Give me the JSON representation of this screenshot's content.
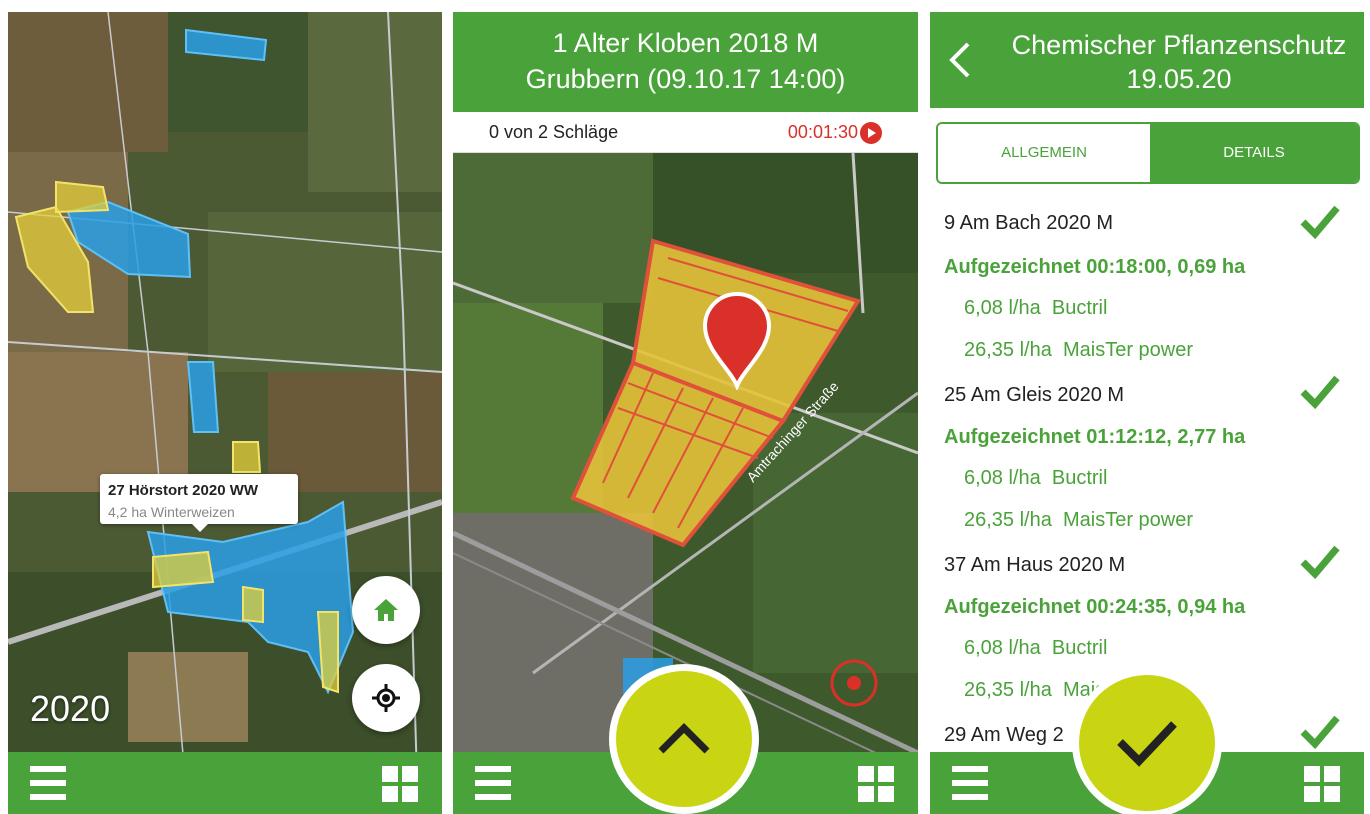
{
  "colors": {
    "brand_green": "#4aa23a",
    "accent_yellow": "#c9d512",
    "record_red": "#d9312a",
    "field_blue": "#2a9fe6",
    "field_yellow": "#e3cf3a"
  },
  "screen1": {
    "year": "2020",
    "tooltip": {
      "title": "27 Hörstort 2020 WW",
      "subtitle": "4,2 ha Winterweizen"
    },
    "buttons": {
      "home_icon": "home-icon",
      "locate_icon": "crosshair-icon"
    },
    "bottombar": {
      "menu_icon": "hamburger-icon",
      "grid_icon": "grid-icon"
    }
  },
  "screen2": {
    "header": {
      "line1": "1 Alter Kloben 2018 M",
      "line2": "Grubbern (09.10.17 14:00)"
    },
    "status": {
      "count": "0 von 2 Schläge",
      "timer": "00:01:30"
    },
    "map_label": "Amtrachinger Straße",
    "bottombar": {
      "menu_icon": "hamburger-icon",
      "grid_icon": "grid-icon",
      "center_icon": "chevron-up-icon"
    }
  },
  "screen3": {
    "header": {
      "line1": "Chemischer Pflanzenschutz",
      "line2": "19.05.20"
    },
    "tabs": [
      "ALLGEMEIN",
      "DETAILS"
    ],
    "entries": [
      {
        "field": "9 Am Bach 2020 M",
        "recorded": "Aufgezeichnet 00:18:00, 0,69 ha",
        "products": [
          {
            "rate": "6,08 l/ha",
            "name": "Buctril"
          },
          {
            "rate": "26,35 l/ha",
            "name": "MaisTer power"
          }
        ]
      },
      {
        "field": "25 Am Gleis 2020 M",
        "recorded": "Aufgezeichnet 01:12:12, 2,77 ha",
        "products": [
          {
            "rate": "6,08 l/ha",
            "name": "Buctril"
          },
          {
            "rate": "26,35 l/ha",
            "name": "MaisTer power"
          }
        ]
      },
      {
        "field": "37 Am Haus 2020 M",
        "recorded": "Aufgezeichnet 00:24:35, 0,94 ha",
        "products": [
          {
            "rate": "6,08 l/ha",
            "name": "Buctril"
          },
          {
            "rate": "26,35 l/ha",
            "name": "MaisTer power"
          }
        ]
      },
      {
        "field": "29 Am Weg 2",
        "recorded": "",
        "products": []
      }
    ],
    "bottombar": {
      "menu_icon": "hamburger-icon",
      "grid_icon": "grid-icon",
      "center_icon": "checkmark-icon"
    }
  }
}
